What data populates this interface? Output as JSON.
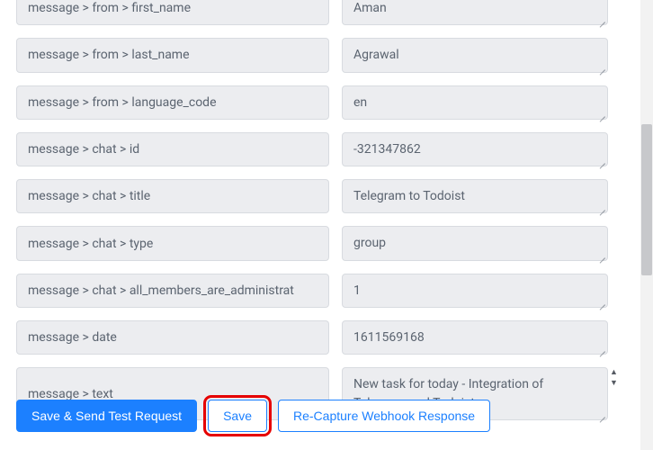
{
  "fields": [
    {
      "key": "message > from > first_name",
      "value": "Aman",
      "multi": false,
      "spinner": false
    },
    {
      "key": "message > from > last_name",
      "value": "Agrawal",
      "multi": false,
      "spinner": false
    },
    {
      "key": "message > from > language_code",
      "value": "en",
      "multi": false,
      "spinner": false
    },
    {
      "key": "message > chat > id",
      "value": "-321347862",
      "multi": false,
      "spinner": false
    },
    {
      "key": "message > chat > title",
      "value": "Telegram to Todoist",
      "multi": false,
      "spinner": false
    },
    {
      "key": "message > chat > type",
      "value": "group",
      "multi": false,
      "spinner": false
    },
    {
      "key": "message > chat > all_members_are_administrat",
      "value": "1",
      "multi": false,
      "spinner": false
    },
    {
      "key": "message > date",
      "value": "1611569168",
      "multi": false,
      "spinner": false
    },
    {
      "key": "message > text",
      "value": "New task for today - Integration of Telegram and Todoist",
      "multi": true,
      "spinner": true
    }
  ],
  "buttons": {
    "primary": "Save & Send Test Request",
    "save": "Save",
    "recapture": "Re-Capture Webhook Response"
  }
}
